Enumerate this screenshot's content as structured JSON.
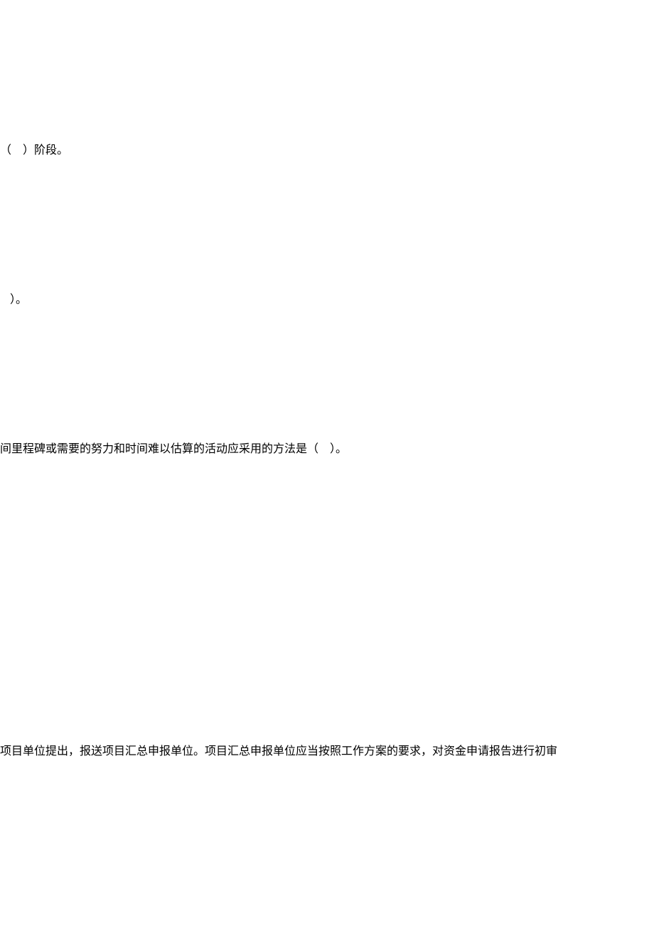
{
  "lines": {
    "l1": "（　）阶段。",
    "l2": "）。",
    "l3": "间里程碑或需要的努力和时间难以估算的活动应采用的方法是（　）。",
    "l4": "项目单位提出，报送项目汇总申报单位。项目汇总申报单位应当按照工作方案的要求，对资金申请报告进行初审"
  }
}
